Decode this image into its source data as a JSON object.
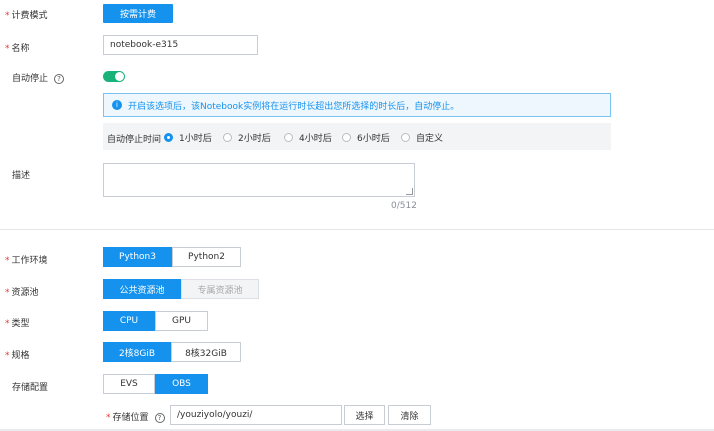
{
  "billing": {
    "label": "计费模式",
    "button": "按需计费"
  },
  "name": {
    "label": "名称",
    "value": "notebook-e315"
  },
  "auto_stop": {
    "label": "自动停止",
    "enabled": true,
    "info": "开启该选项后，该Notebook实例将在运行时长超出您所选择的时长后，自动停止。",
    "time_label": "自动停止时间",
    "options": [
      "1小时后",
      "2小时后",
      "4小时后",
      "6小时后",
      "自定义"
    ],
    "selected": "1小时后"
  },
  "description": {
    "label": "描述",
    "counter": "0/512"
  },
  "environment": {
    "label": "工作环境",
    "options": [
      "Python3",
      "Python2"
    ],
    "selected": "Python3"
  },
  "resource_pool": {
    "label": "资源池",
    "options": [
      "公共资源池",
      "专属资源池"
    ],
    "selected": "公共资源池"
  },
  "type": {
    "label": "类型",
    "options": [
      "CPU",
      "GPU"
    ],
    "selected": "CPU"
  },
  "spec": {
    "label": "规格",
    "options": [
      "2核8GiB",
      "8核32GiB"
    ],
    "selected": "2核8GiB"
  },
  "storage": {
    "label": "存储配置",
    "options": [
      "EVS",
      "OBS"
    ],
    "selected": "OBS",
    "location_label": "存储位置",
    "location_value": "/youziyolo/youzi/",
    "select_button": "选择",
    "clear_button": "清除"
  },
  "colors": {
    "primary": "#1592ed",
    "required": "#e53935",
    "toggle": "#19b37a"
  }
}
